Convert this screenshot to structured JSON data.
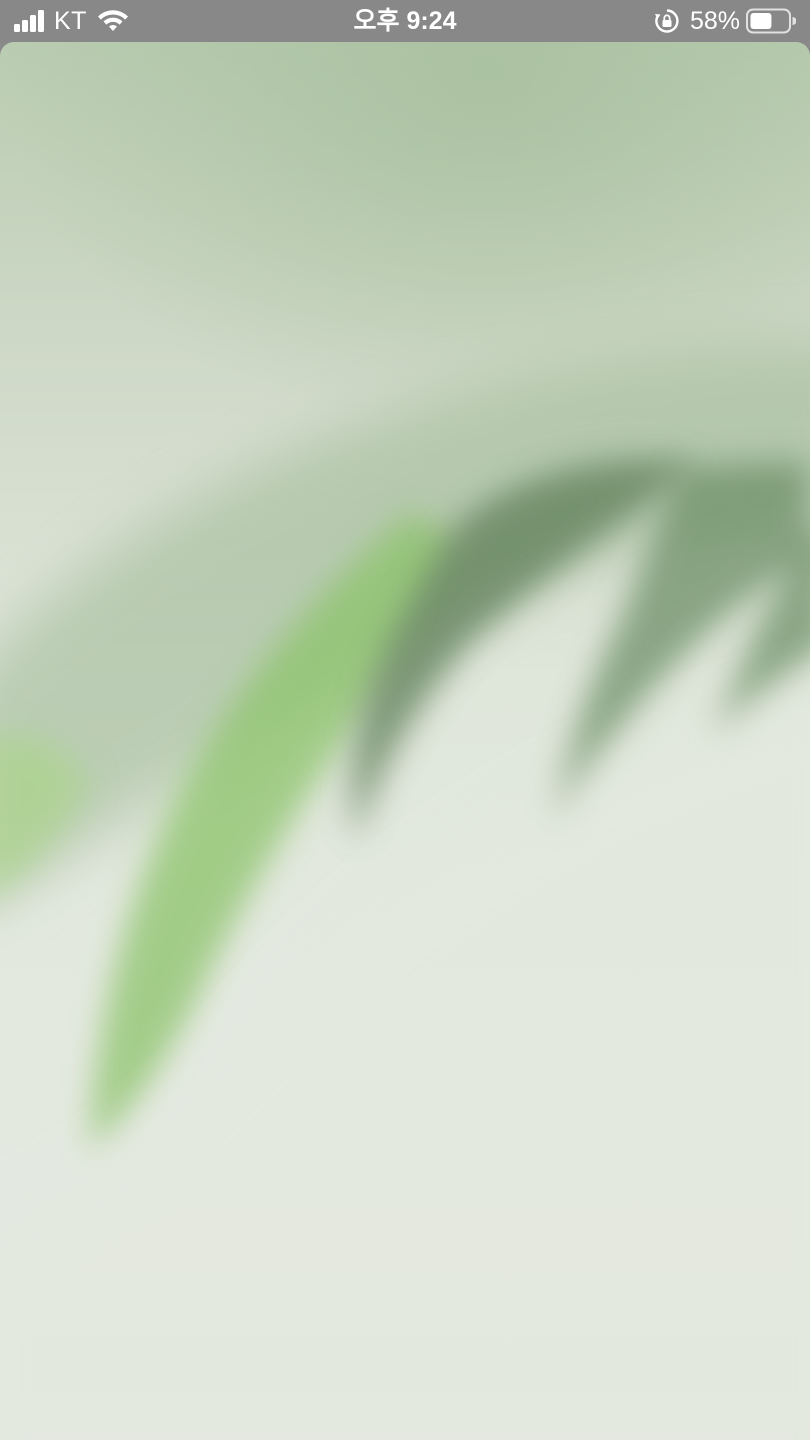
{
  "status_bar": {
    "carrier": "KT",
    "time": "오후 9:24",
    "battery_percent": "58%",
    "battery_level": 0.58,
    "signal_icon": "cellular-signal-icon",
    "wifi_icon": "wifi-icon",
    "orientation_lock_icon": "orientation-lock-icon",
    "battery_icon": "battery-icon"
  },
  "wallpaper": {
    "description_colors": {
      "pale_green": "#dfe6da",
      "leaf_dark": "#6f8f6a",
      "leaf_bright": "#8fca6e"
    }
  }
}
